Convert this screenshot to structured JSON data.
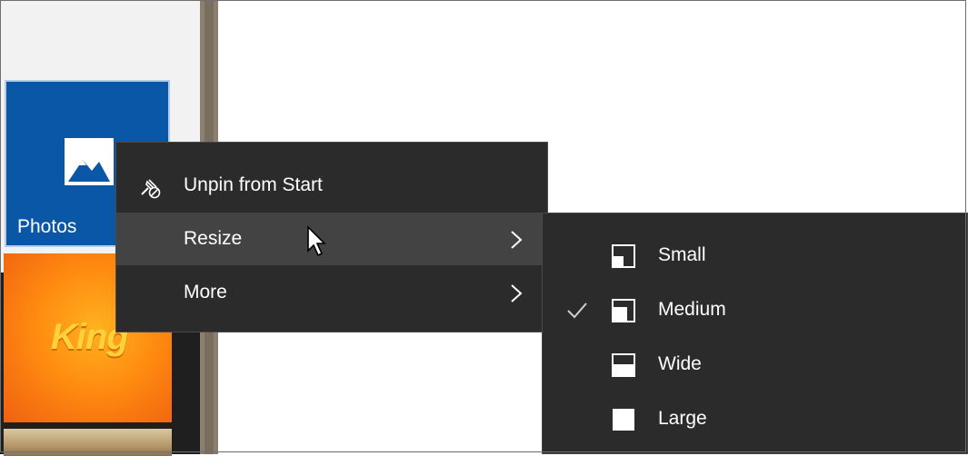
{
  "start_menu": {
    "tiles": [
      {
        "label": "Photos",
        "icon": "photos-icon",
        "color": "#0a57a8"
      },
      {
        "label": "",
        "icon": "king-logo",
        "logo_text": "King",
        "color": "#ff8c10"
      },
      {
        "label": "",
        "icon": "landscape-thumbnail"
      }
    ]
  },
  "context_menu": {
    "items": [
      {
        "label": "Unpin from Start",
        "icon": "unpin-icon",
        "has_submenu": false
      },
      {
        "label": "Resize",
        "icon": "",
        "has_submenu": true,
        "highlighted": true
      },
      {
        "label": "More",
        "icon": "",
        "has_submenu": true
      }
    ]
  },
  "resize_submenu": {
    "items": [
      {
        "label": "Small",
        "icon": "small-tile-icon",
        "checked": false
      },
      {
        "label": "Medium",
        "icon": "medium-tile-icon",
        "checked": true
      },
      {
        "label": "Wide",
        "icon": "wide-tile-icon",
        "checked": false
      },
      {
        "label": "Large",
        "icon": "large-tile-icon",
        "checked": false
      }
    ]
  },
  "colors": {
    "menu_bg": "#2b2b2b",
    "menu_hover": "#434343",
    "menu_text": "#ffffff",
    "photos_tile": "#0a57a8"
  }
}
